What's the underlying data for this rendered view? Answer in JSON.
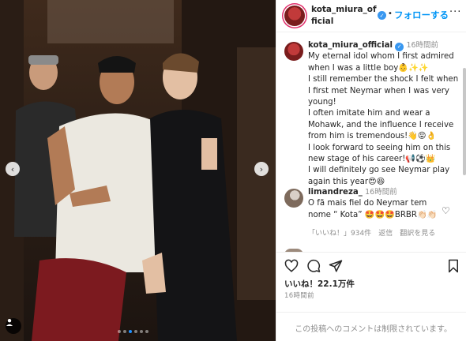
{
  "post": {
    "author": "kota_miura_official",
    "follow_label": "フォローする",
    "separator": "•",
    "more_icon": "more-icon",
    "photo": {
      "slide_count": 6,
      "active_slide": 3
    },
    "caption": {
      "username": "kota_miura_official",
      "time": "16時間前",
      "lines": [
        "My eternal idol whom I first admired when I was a little boy👶✨✨",
        "I still remember the shock I felt when I first met Neymar when I was very young!",
        "I often imitate him and wear a Mohawk, and the influence I receive from him is tremendous!👋😝👌",
        "I look forward to seeing him on this new stage of his career!📢⚽👑",
        "I will definitely go see Neymar play again this year😍😆"
      ]
    },
    "comment": {
      "username": "limandreza_",
      "time": "16時間前",
      "text": "O fã mais fiel do Neymar tem nome “ Kota” 🤩🤩🤩BRBR👏🏻👏🏻",
      "likes": "「いいね！」934件",
      "reply": "返信",
      "translate": "翻訳を見る"
    },
    "likes_count": "いいね！22.1万件",
    "posted_ago": "16時間前",
    "comments_disabled": "この投稿へのコメントは制限されています。"
  },
  "colors": {
    "link": "#0095f6",
    "verified": "#3897f0",
    "muted": "#8e8e8e",
    "text": "#262626"
  }
}
